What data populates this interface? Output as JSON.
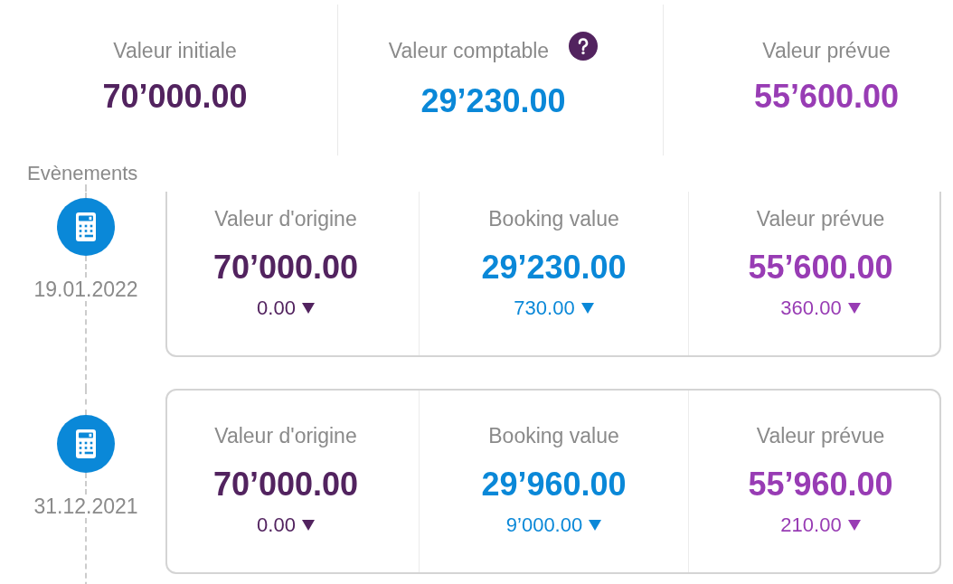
{
  "summary": [
    {
      "label": "Valeur initiale",
      "value": "70’000.00",
      "color": "#52235f",
      "help": false
    },
    {
      "label": "Valeur comptable",
      "value": "29’230.00",
      "color": "#0a88d8",
      "help": true
    },
    {
      "label": "Valeur prévue",
      "value": "55’600.00",
      "color": "#983cb4",
      "help": false
    }
  ],
  "events": {
    "title": "Evènements",
    "items": [
      {
        "date": "19.01.2022",
        "cells": [
          {
            "label": "Valeur d'origine",
            "value": "70’000.00",
            "change": "0.00",
            "decreased": true,
            "color": "#52235f"
          },
          {
            "label": "Booking value",
            "value": "29’230.00",
            "change": "730.00",
            "decreased": true,
            "color": "#0a88d8"
          },
          {
            "label": "Valeur prévue",
            "value": "55’600.00",
            "change": "360.00",
            "decreased": true,
            "color": "#983cb4"
          }
        ]
      },
      {
        "date": "31.12.2021",
        "cells": [
          {
            "label": "Valeur d'origine",
            "value": "70’000.00",
            "change": "0.00",
            "decreased": true,
            "color": "#52235f"
          },
          {
            "label": "Booking value",
            "value": "29’960.00",
            "change": "9’000.00",
            "decreased": true,
            "color": "#0a88d8"
          },
          {
            "label": "Valeur prévue",
            "value": "55’960.00",
            "change": "210.00",
            "decreased": true,
            "color": "#983cb4"
          }
        ]
      }
    ]
  }
}
